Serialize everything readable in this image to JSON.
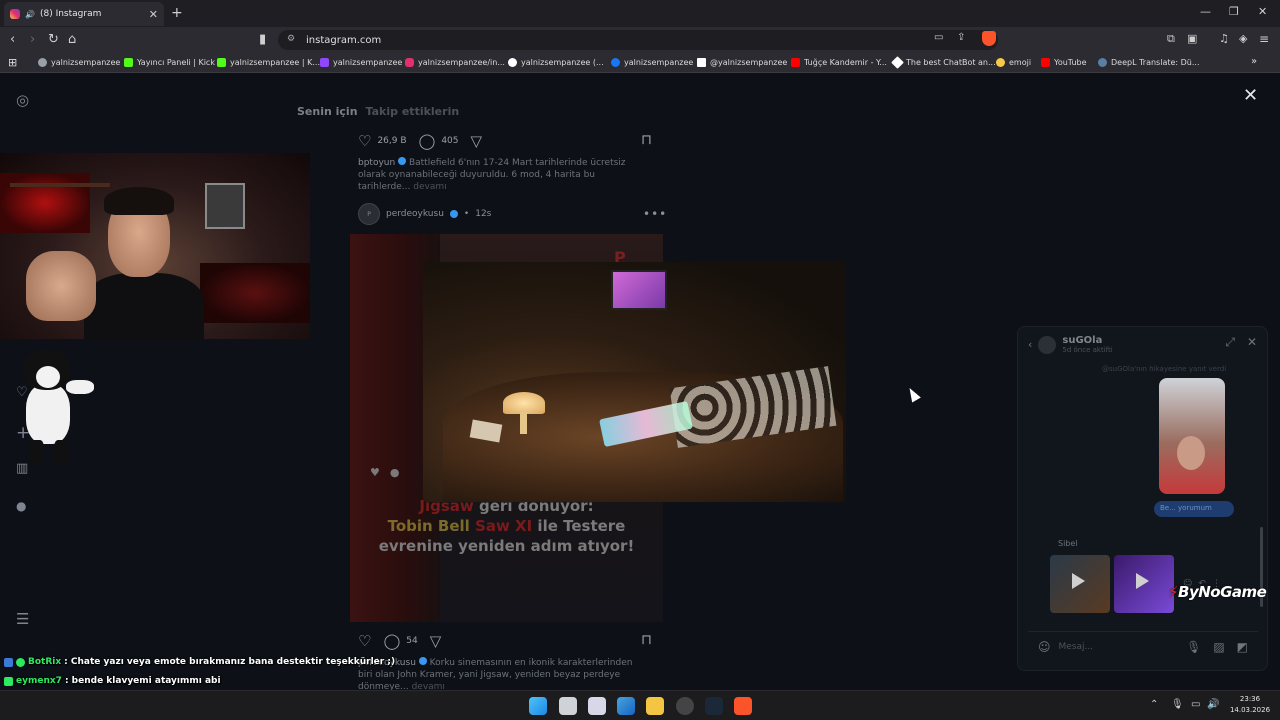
{
  "browser": {
    "tab_title": "(8) Instagram",
    "url": "instagram.com",
    "new_tab": "+",
    "bookmarks": [
      {
        "label": "yalnizsempanzee",
        "color": "#9aa0a8"
      },
      {
        "label": "Yayıncı Paneli | Kick",
        "color": "#53fc18"
      },
      {
        "label": "yalnizsempanzee | K...",
        "color": "#53fc18"
      },
      {
        "label": "yalnizsempanzee",
        "color": "#9146ff"
      },
      {
        "label": "yalnizsempanzee/in...",
        "color": "#e1306c"
      },
      {
        "label": "yalnizsempanzee (...",
        "color": "#ffffff"
      },
      {
        "label": "yalnizsempanzee",
        "color": "#1877f2"
      },
      {
        "label": "@yalnizsempanzee",
        "color": "#ffffff"
      },
      {
        "label": "Tuğçe Kandemir - Y...",
        "color": "#ff0000"
      },
      {
        "label": "The best ChatBot an...",
        "color": "#ffffff"
      },
      {
        "label": "emoji",
        "color": "#f7c948"
      },
      {
        "label": "YouTube",
        "color": "#ff0000"
      },
      {
        "label": "DeepL Translate: Dü...",
        "color": "#0f2b46"
      }
    ]
  },
  "feed": {
    "tabs": [
      "Senin için",
      "Takip ettiklerin"
    ],
    "post1": {
      "likes": "26,9 B",
      "comments": "405",
      "username": "bptoyun",
      "caption": "Battlefield 6'nın 17-24 Mart tarihlerinde ücretsiz olarak oynanabileceği duyuruldu. 6 mod, 4 harita bu tarihlerde...",
      "more": "devamı"
    },
    "post2": {
      "username": "perdeoykusu",
      "time": "12s",
      "avatar_text": "P",
      "badge": "P",
      "headline_red": "Jigsaw",
      "headline_rest1": " geri dönüyor:",
      "headline_gold": "Tobin Bell",
      "headline_red2": " Saw XI",
      "headline_rest2": " ile Testere",
      "headline_line3": "evrenine yeniden adım atıyor!",
      "comments": "54",
      "caption": "Korku sinemasının en ikonik karakterlerinden biri olan John Kramer, yani Jigsaw, yeniden beyaz perdeye dönmeye...",
      "more": "devamı"
    }
  },
  "dm": {
    "name": "suGOla",
    "status": "5d önce aktifti",
    "story_note": "@suGOla'nın hikayesine yanıt verdi",
    "bubble": "Be... yorumum",
    "sender": "Sibel",
    "input_placeholder": "Mesaj..."
  },
  "watermark": "ByNoGame",
  "chat": [
    {
      "user": "BotRix",
      "message": " : Chate yazı veya emote bırakmanız bana destektir teşekkürler ;)"
    },
    {
      "user": "eymenx7",
      "message": " : bende klavyemi atayımmı abi"
    }
  ],
  "clock": {
    "time": "23:36",
    "date": "14.03.2026"
  },
  "colors": {
    "accent": "#fb542b",
    "verified": "#3897f0",
    "chat_user": "#2eea5e"
  }
}
